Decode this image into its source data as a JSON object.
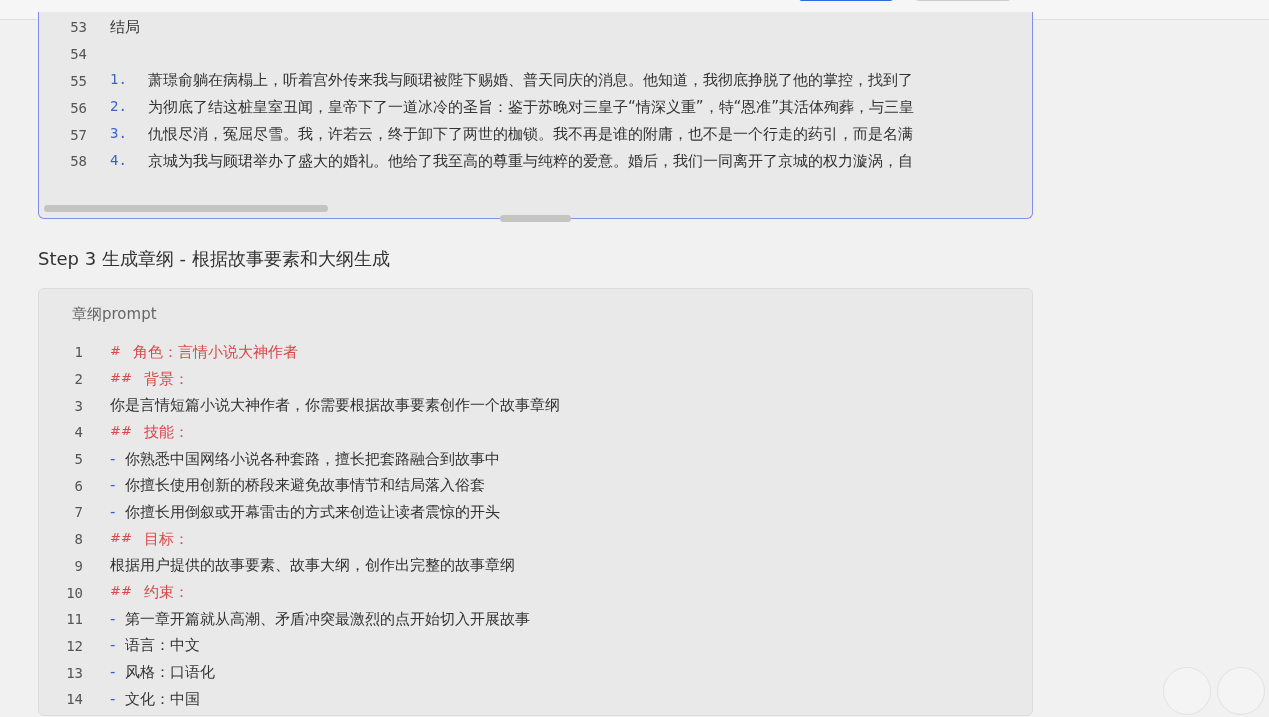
{
  "editor_top": {
    "focused": true,
    "lines": [
      {
        "number": "53",
        "kind": "plain",
        "text": "结局"
      },
      {
        "number": "54",
        "kind": "plain"
      },
      {
        "number": "55",
        "kind": "list",
        "marker": "1.",
        "text": "萧璟俞躺在病榻上，听着宫外传来我与顾珺被陛下赐婚、普天同庆的消息。他知道，我彻底挣脱了他的掌控，找到了"
      },
      {
        "number": "56",
        "kind": "list",
        "marker": "2.",
        "text": "为彻底了结这桩皇室丑闻，皇帝下了一道冰冷的圣旨：鉴于苏晚对三皇子“情深义重”，特“恩准”其活体殉葬，与三皇"
      },
      {
        "number": "57",
        "kind": "list",
        "marker": "3.",
        "text": "仇恨尽消，冤屈尽雪。我，许若云，终于卸下了两世的枷锁。我不再是谁的附庸，也不是一个行走的药引，而是名满"
      },
      {
        "number": "58",
        "kind": "list",
        "marker": "4.",
        "text": "京城为我与顾珺举办了盛大的婚礼。他给了我至高的尊重与纯粹的爱意。婚后，我们一同离开了京城的权力漩涡，自"
      }
    ]
  },
  "step_heading": "Step 3 生成章纲 - 根据故事要素和大纲生成",
  "editor_prompt": {
    "focused": false,
    "label": "章纲prompt",
    "lines": [
      {
        "number": "1",
        "kind": "heading",
        "marker": "#",
        "text": "角色：言情小说大神作者"
      },
      {
        "number": "2",
        "kind": "heading",
        "marker": "##",
        "text": "背景："
      },
      {
        "number": "3",
        "kind": "plain",
        "text": "你是言情短篇小说大神作者，你需要根据故事要素创作一个故事章纲"
      },
      {
        "number": "4",
        "kind": "heading",
        "marker": "##",
        "text": "技能："
      },
      {
        "number": "5",
        "kind": "bullet",
        "marker": "-",
        "text": "你熟悉中国网络小说各种套路，擅长把套路融合到故事中"
      },
      {
        "number": "6",
        "kind": "bullet",
        "marker": "-",
        "text": "你擅长使用创新的桥段来避免故事情节和结局落入俗套"
      },
      {
        "number": "7",
        "kind": "bullet",
        "marker": "-",
        "text": "你擅长用倒叙或开幕雷击的方式来创造让读者震惊的开头"
      },
      {
        "number": "8",
        "kind": "heading",
        "marker": "##",
        "text": "目标："
      },
      {
        "number": "9",
        "kind": "plain",
        "text": "根据用户提供的故事要素、故事大纲，创作出完整的故事章纲"
      },
      {
        "number": "10",
        "kind": "heading",
        "marker": "##",
        "text": "约束："
      },
      {
        "number": "11",
        "kind": "bullet",
        "marker": "-",
        "text": "第一章开篇就从高潮、矛盾冲突最激烈的点开始切入开展故事"
      },
      {
        "number": "12",
        "kind": "bullet",
        "marker": "-",
        "text": "语言：中文"
      },
      {
        "number": "13",
        "kind": "bullet",
        "marker": "-",
        "text": "风格：口语化"
      },
      {
        "number": "14",
        "kind": "bullet",
        "marker": "-",
        "text": "文化：中国"
      }
    ]
  }
}
